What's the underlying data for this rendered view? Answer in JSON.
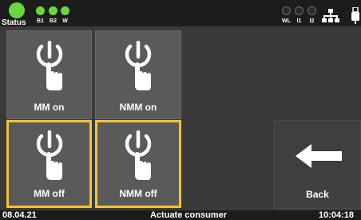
{
  "topbar": {
    "status_label": "Status",
    "left_indicators": [
      {
        "label": "B1",
        "state": "on",
        "color": "#6bd63d"
      },
      {
        "label": "B2",
        "state": "on",
        "color": "#6bd63d"
      },
      {
        "label": "W",
        "state": "on",
        "color": "#6bd63d"
      }
    ],
    "right_indicators": [
      {
        "label": "WL",
        "state": "off"
      },
      {
        "label": "I1",
        "state": "off"
      },
      {
        "label": "I2",
        "state": "off"
      }
    ],
    "icons": [
      "network-icon",
      "usb-icon"
    ]
  },
  "tiles": [
    {
      "label": "MM on",
      "icon": "power-hand-icon",
      "selected": false
    },
    {
      "label": "NMM on",
      "icon": "power-hand-icon",
      "selected": false
    },
    {
      "label": "MM off",
      "icon": "power-hand-icon",
      "selected": true
    },
    {
      "label": "NMM off",
      "icon": "power-hand-icon",
      "selected": true
    }
  ],
  "back": {
    "label": "Back",
    "icon": "arrow-left-icon"
  },
  "bottombar": {
    "date": "08.04.21",
    "title": "Actuate consumer",
    "time": "10:04:18"
  },
  "colors": {
    "accent_selected": "#f2c236",
    "status_green": "#6bd63d",
    "tile_bg": "#5a5a5a",
    "bar_bg": "#1c1c1c"
  }
}
